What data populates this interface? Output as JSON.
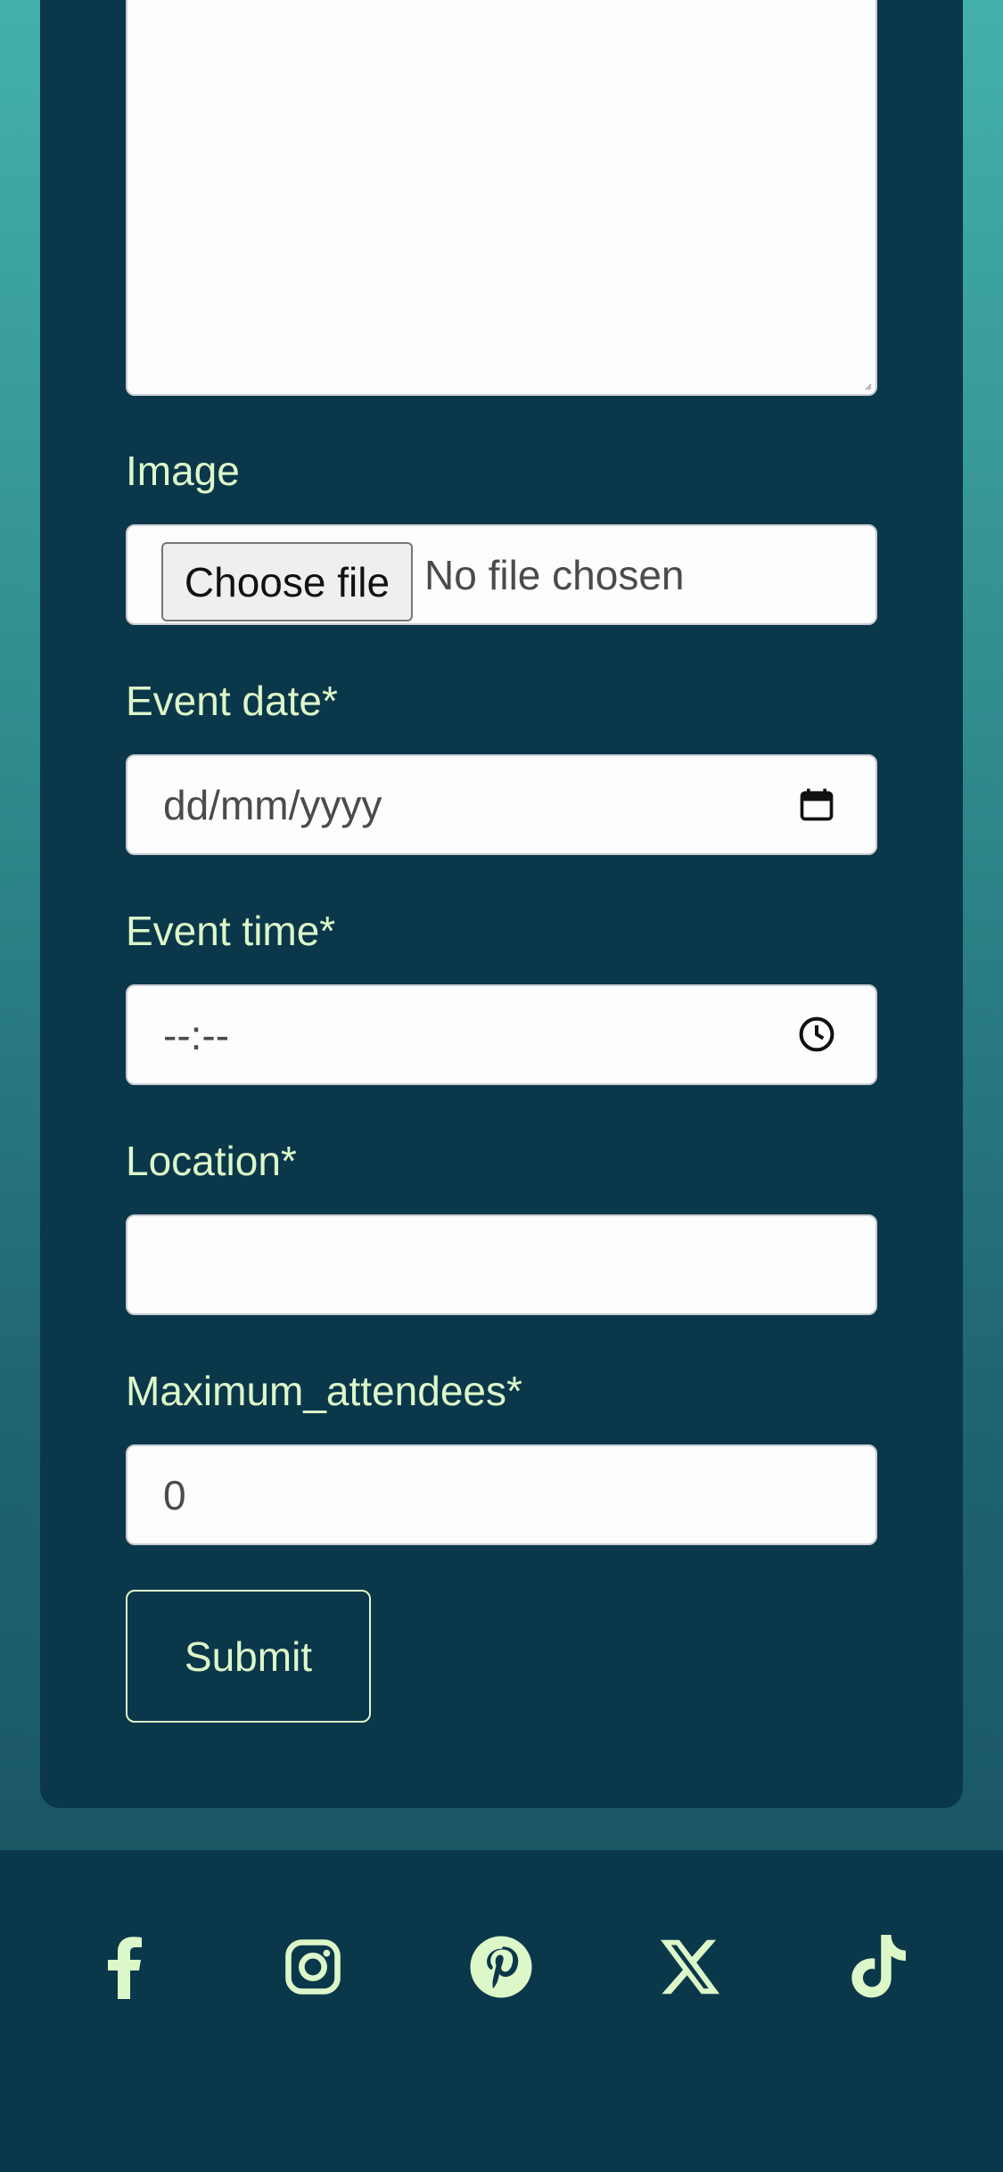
{
  "form": {
    "image_label": "Image",
    "file_button_label": "Choose file",
    "file_status": "No file chosen",
    "event_date_label": "Event date*",
    "event_date_placeholder": "dd/mm/yyyy",
    "event_time_label": "Event time*",
    "event_time_placeholder": "--:--",
    "location_label": "Location*",
    "location_value": "",
    "max_attendees_label": "Maximum_attendees*",
    "max_attendees_value": "0",
    "submit_label": "Submit"
  },
  "footer": {
    "social_icons": [
      "facebook-icon",
      "instagram-icon",
      "pinterest-icon",
      "x-icon",
      "tiktok-icon"
    ]
  },
  "colors": {
    "card": "#0b374b",
    "accent_text": "#ddf8c8",
    "gradient_top": "#44b0aa",
    "gradient_bottom": "#174e5c"
  }
}
